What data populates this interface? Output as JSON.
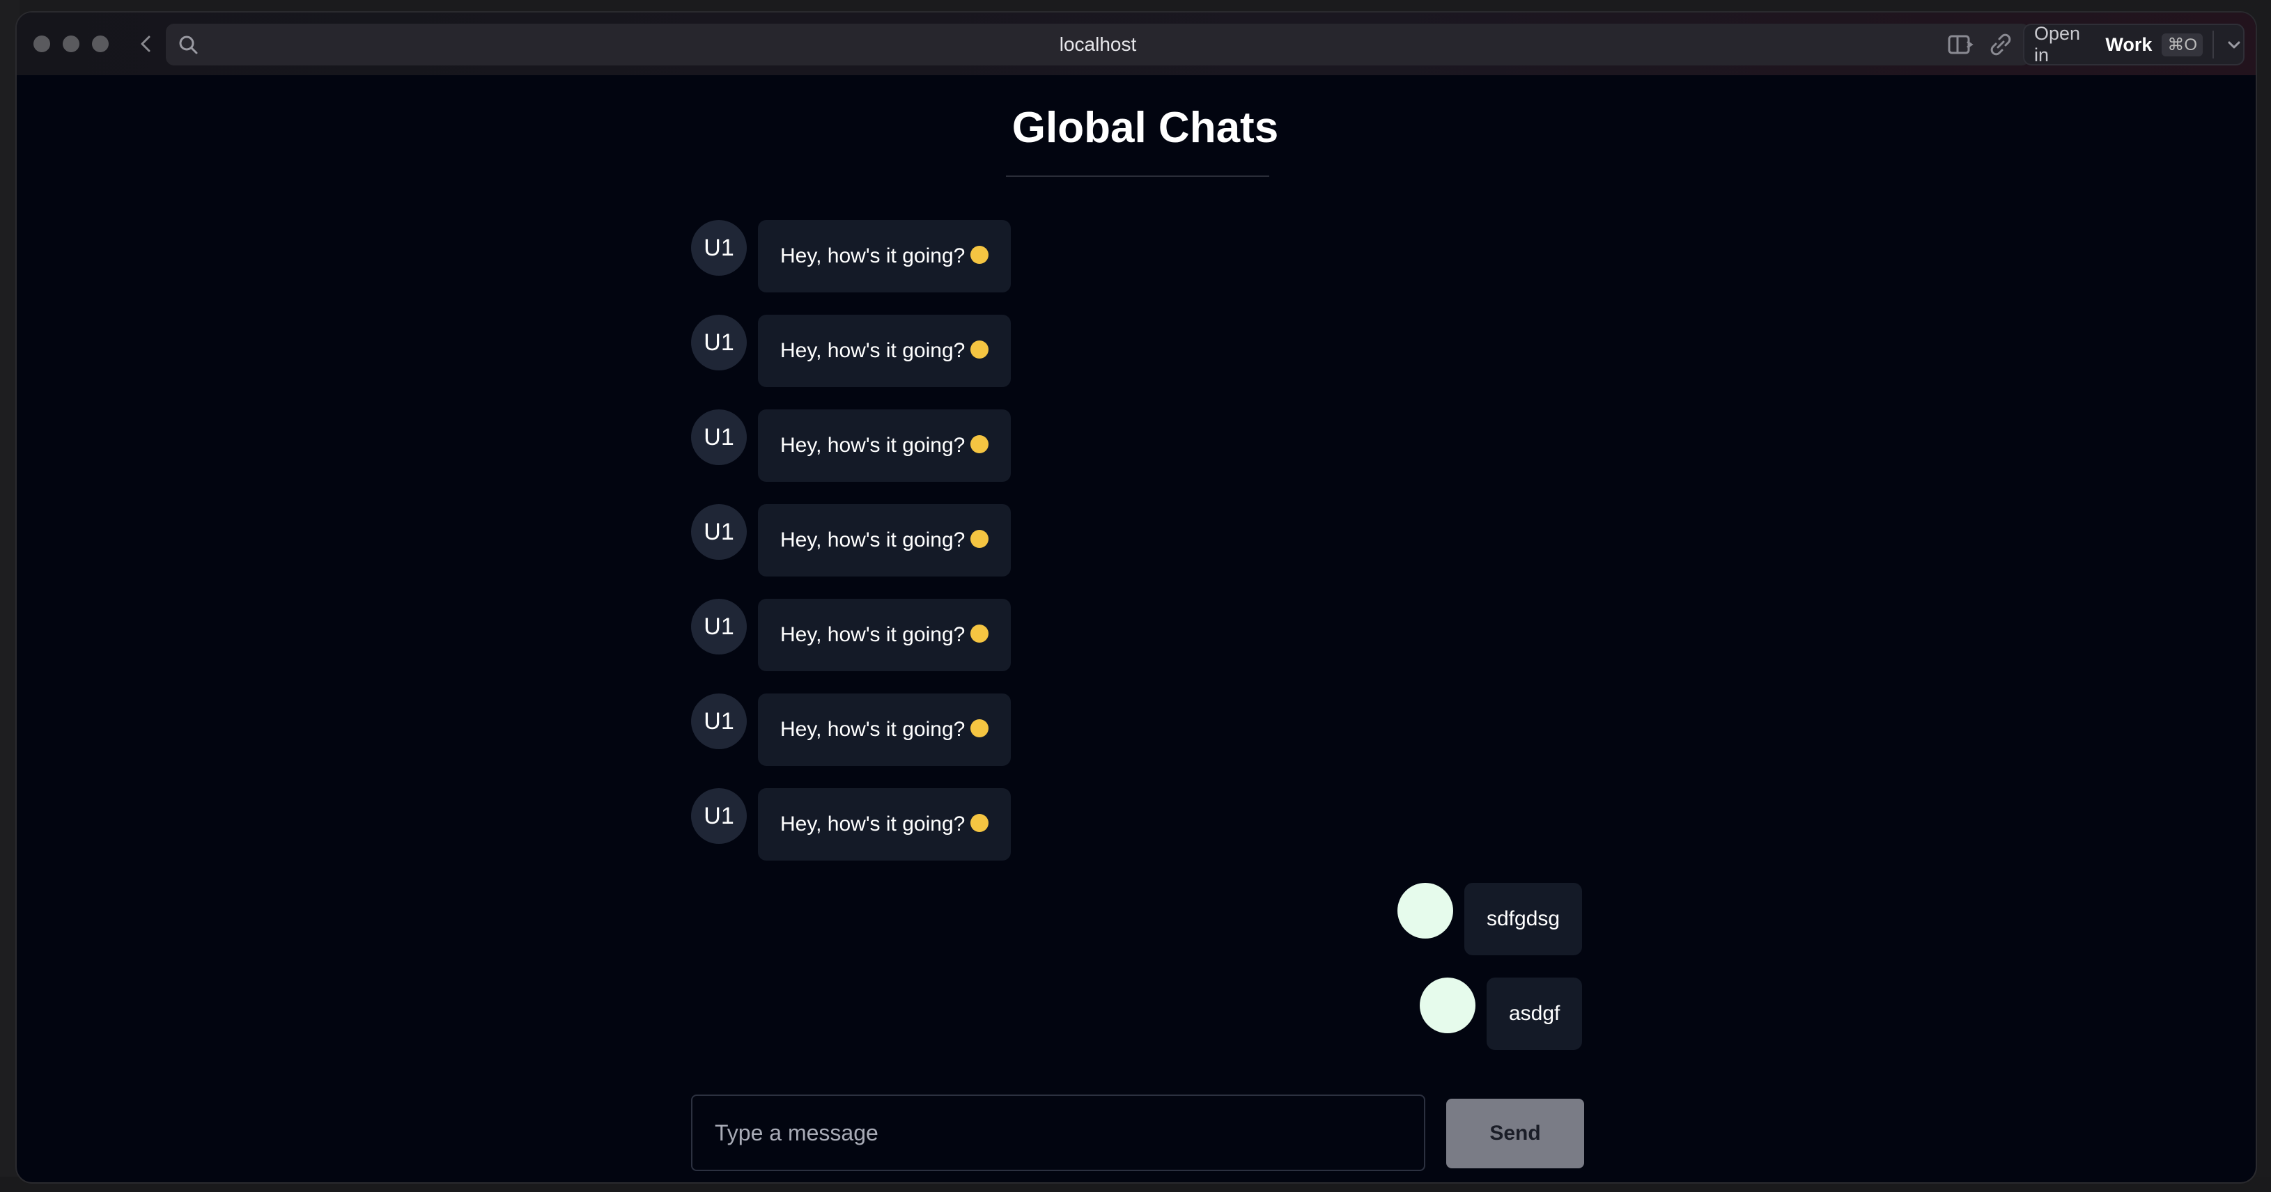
{
  "browser": {
    "url": "localhost",
    "open_in_label": "Open in",
    "open_in_target": "Work",
    "open_in_shortcut": "⌘O"
  },
  "page": {
    "title": "Global Chats"
  },
  "messages": [
    {
      "avatar": "U1",
      "text": "Hey, how's it going?",
      "emoji": "smiling-face-emoji",
      "side": "left"
    },
    {
      "avatar": "U1",
      "text": "Hey, how's it going?",
      "emoji": "smiling-face-emoji",
      "side": "left"
    },
    {
      "avatar": "U1",
      "text": "Hey, how's it going?",
      "emoji": "smiling-face-emoji",
      "side": "left"
    },
    {
      "avatar": "U1",
      "text": "Hey, how's it going?",
      "emoji": "smiling-face-emoji",
      "side": "left"
    },
    {
      "avatar": "U1",
      "text": "Hey, how's it going?",
      "emoji": "smiling-face-emoji",
      "side": "left"
    },
    {
      "avatar": "U1",
      "text": "Hey, how's it going?",
      "emoji": "smiling-face-emoji",
      "side": "left"
    },
    {
      "avatar": "U1",
      "text": "Hey, how's it going?",
      "emoji": "smiling-face-emoji",
      "side": "left"
    },
    {
      "avatar": "",
      "text": "sdfgdsg",
      "side": "right"
    },
    {
      "avatar": "",
      "text": "asdgf",
      "side": "right"
    }
  ],
  "composer": {
    "placeholder": "Type a message",
    "value": "",
    "send_label": "Send"
  },
  "colors": {
    "background": "#020510",
    "bubble": "#141a27",
    "avatar_other": "#1f2636",
    "avatar_me": "#e6fbec",
    "send_button": "#7a7c86"
  }
}
